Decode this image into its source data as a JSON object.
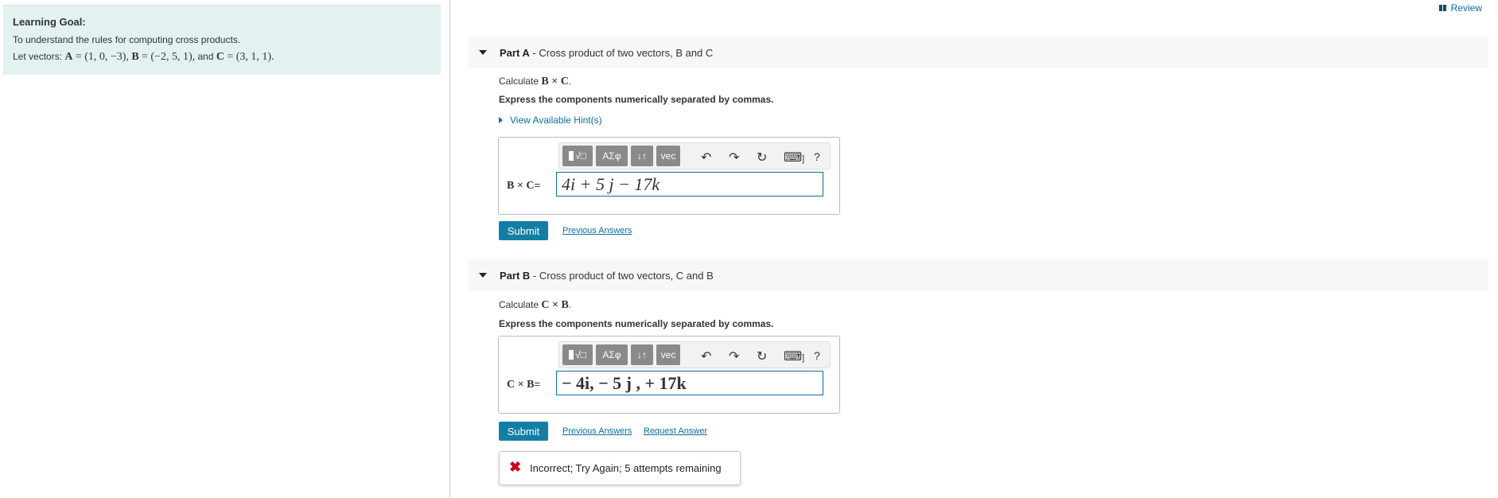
{
  "header": {
    "review_label": "Review"
  },
  "learning_goal": {
    "title": "Learning Goal:",
    "description": "To understand the rules for computing cross products.",
    "vectors_prefix": "Let vectors:",
    "vec_A_name": "A",
    "vec_A_value": "= (1, 0, −3),",
    "vec_B_name": "B",
    "vec_B_value": "= (−2, 5, 1),",
    "and_text": "and",
    "vec_C_name": "C",
    "vec_C_value": "= (3, 1, 1)."
  },
  "toolbar": {
    "templates_label": "√□",
    "symbols_label": "ΑΣφ",
    "sub_sup_label": "↓↑",
    "vec_label": "vec",
    "undo_icon": "↶",
    "redo_icon": "↷",
    "reset_icon": "↻",
    "keyboard_icon": "⌨",
    "keyboard_suffix": "]",
    "help_label": "?"
  },
  "part_a": {
    "part_label": "Part A",
    "title": " - Cross product of two vectors, B and C",
    "calc_prefix": "Calculate",
    "calc_expr": "B × C",
    "calc_suffix": ".",
    "express": "Express the components numerically separated by commas.",
    "hint_label": "View Available Hint(s)",
    "eq_label": "B × C",
    "eq_suffix": "=",
    "answer": "4i + 5 j − 17k",
    "submit_label": "Submit",
    "previous_answers_label": "Previous Answers"
  },
  "part_b": {
    "part_label": "Part B",
    "title": " - Cross product of two vectors, C and B",
    "calc_prefix": "Calculate",
    "calc_expr": "C × B",
    "calc_suffix": ".",
    "express": "Express the components numerically separated by commas.",
    "eq_label": "C × B",
    "eq_suffix": "=",
    "answer": "− 4i, − 5 j , + 17k",
    "submit_label": "Submit",
    "previous_answers_label": "Previous Answers",
    "request_answer_label": "Request Answer",
    "feedback": "Incorrect; Try Again; 5 attempts remaining"
  }
}
